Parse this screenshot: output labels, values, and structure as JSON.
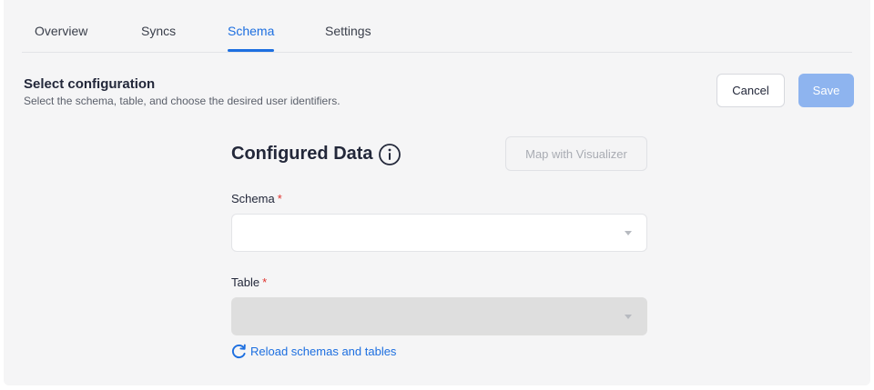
{
  "tabs": [
    {
      "label": "Overview"
    },
    {
      "label": "Syncs"
    },
    {
      "label": "Schema"
    },
    {
      "label": "Settings"
    }
  ],
  "active_tab": "Schema",
  "accent_color": "#1d6fe0",
  "header": {
    "title": "Select configuration",
    "subtitle": "Select the schema, table, and choose the desired user identifiers."
  },
  "actions": {
    "cancel_label": "Cancel",
    "save_label": "Save"
  },
  "config": {
    "title": "Configured Data",
    "info_icon": "info-icon",
    "visualizer_label": "Map with Visualizer",
    "schema": {
      "label": "Schema",
      "required_mark": "*",
      "value": ""
    },
    "table": {
      "label": "Table",
      "required_mark": "*",
      "value": "",
      "disabled": true
    },
    "reload_label": "Reload schemas and tables",
    "reload_icon": "refresh-icon"
  }
}
